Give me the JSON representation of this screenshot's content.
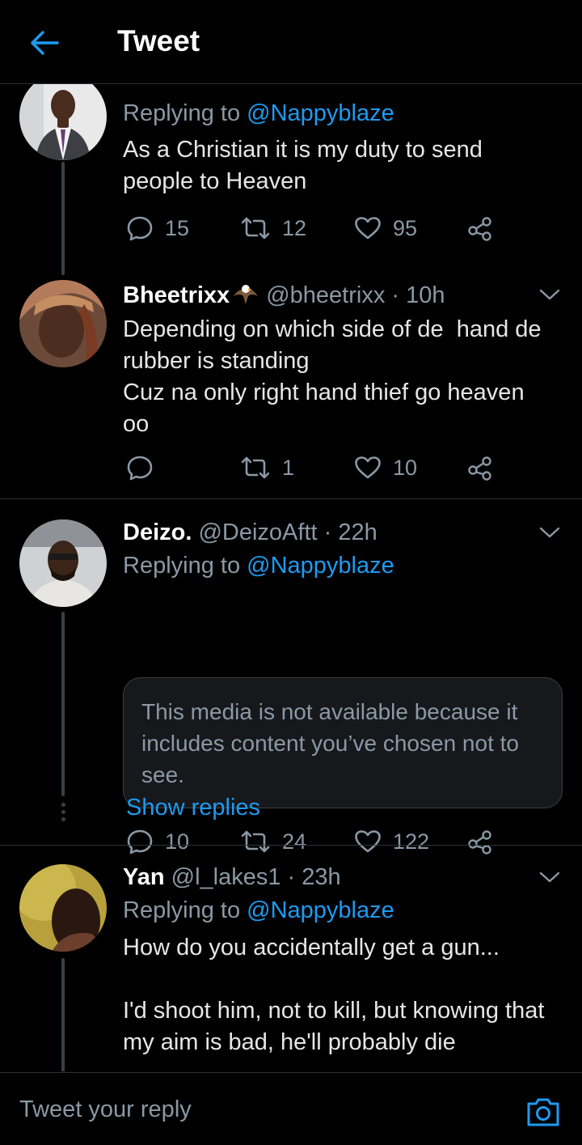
{
  "header": {
    "title": "Tweet"
  },
  "tweets": [
    {
      "replying_prefix": "Replying to ",
      "replying_to": "@Nappyblaze",
      "text": "As a Christian it is my duty to send\npeople to Heaven",
      "reply_count": "15",
      "retweet_count": "12",
      "like_count": "95"
    },
    {
      "name": "Bheetrixx",
      "handle_time": " @bheetrixx · 10h",
      "text": "Depending on which side of de  hand de\nrubber is standing\nCuz na only right hand thief go heaven\noo",
      "reply_count": "",
      "retweet_count": "1",
      "like_count": "10"
    },
    {
      "name": "Deizo.",
      "handle_time": " @DeizoAftt · 22h",
      "replying_prefix": "Replying to ",
      "replying_to": "@Nappyblaze",
      "media_notice": "This media is not available because it includes content you’ve chosen not to see.",
      "reply_count": "10",
      "retweet_count": "24",
      "like_count": "122",
      "show_replies": "Show replies"
    },
    {
      "name": "Yan",
      "handle_time": " @l_lakes1 · 23h",
      "replying_prefix": "Replying to ",
      "replying_to": "@Nappyblaze",
      "text": "How do you accidentally get a gun...\n\nI'd shoot him, not to kill, but knowing that\nmy aim is bad, he'll probably die"
    }
  ],
  "reply_bar": {
    "placeholder": "Tweet your reply"
  },
  "colors": {
    "accent": "#1d9bf0",
    "background": "#000000",
    "muted": "#8b98a5",
    "separator": "#2f3336"
  },
  "icons": [
    "back-arrow-icon",
    "reply-icon",
    "retweet-icon",
    "like-icon",
    "share-icon",
    "chevron-down-icon",
    "camera-icon",
    "eagle-emoji-icon"
  ]
}
